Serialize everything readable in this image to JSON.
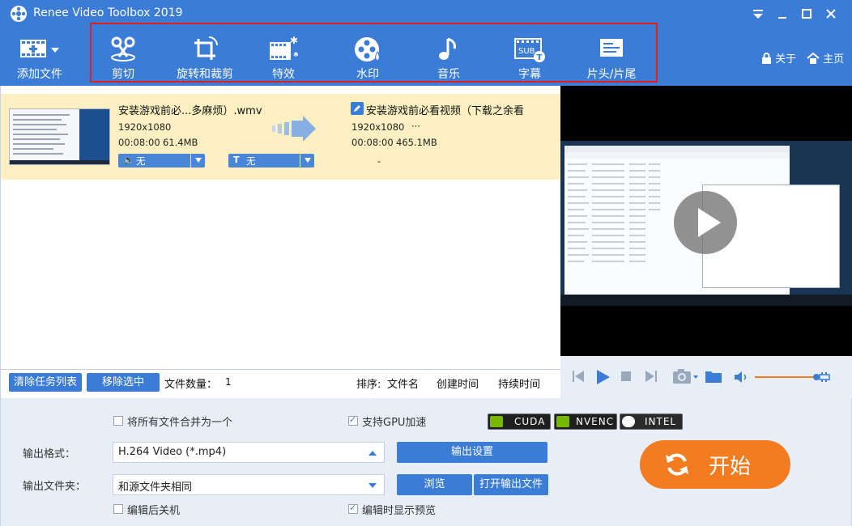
{
  "window": {
    "title": "Renee Video Toolbox 2019"
  },
  "toolbar": {
    "add_file": "添加文件",
    "cut": "剪切",
    "rotate_crop": "旋转和裁剪",
    "effects": "特效",
    "watermark": "水印",
    "music": "音乐",
    "subtitle": "字幕",
    "intro_outro": "片头/片尾",
    "about": "关于",
    "home": "主页"
  },
  "file": {
    "source_name": "安装游戏前必...多麻烦）.wmv",
    "source_resolution": "1920x1080",
    "source_duration": "00:08:00",
    "source_size": "61.4MB",
    "audio_track": "无",
    "subtitle_track": "无",
    "output_name": "安装游戏前必看视频（下载之余看",
    "output_resolution": "1920x1080",
    "output_more": "···",
    "output_duration": "00:08:00",
    "output_size": "465.1MB",
    "output_dash": "-"
  },
  "tasks": {
    "clear_list": "清除任务列表",
    "remove_selected": "移除选中",
    "file_count_label": "文件数量：",
    "file_count": "1",
    "sort_label": "排序:",
    "sort_filename": "文件名",
    "sort_created": "创建时间",
    "sort_duration": "持续时间"
  },
  "settings": {
    "merge_all": "将所有文件合并为一个",
    "gpu_accel": "支持GPU加速",
    "gpu_cuda": "CUDA",
    "gpu_nvenc": "NVENC",
    "gpu_intel": "INTEL",
    "output_format_label": "输出格式：",
    "output_format_value": "H.264 Video (*.mp4)",
    "output_settings": "输出设置",
    "output_folder_label": "输出文件夹：",
    "output_folder_value": "和源文件夹相同",
    "browse": "浏览",
    "open_output": "打开输出文件",
    "shutdown_after": "编辑后关机",
    "show_preview": "编辑时显示预览",
    "start": "开始"
  },
  "colors": {
    "header_blue": "#3b7cd6",
    "row_highlight": "#fcf0c2",
    "start_orange": "#f47c20",
    "annotation_red": "#e02020"
  }
}
